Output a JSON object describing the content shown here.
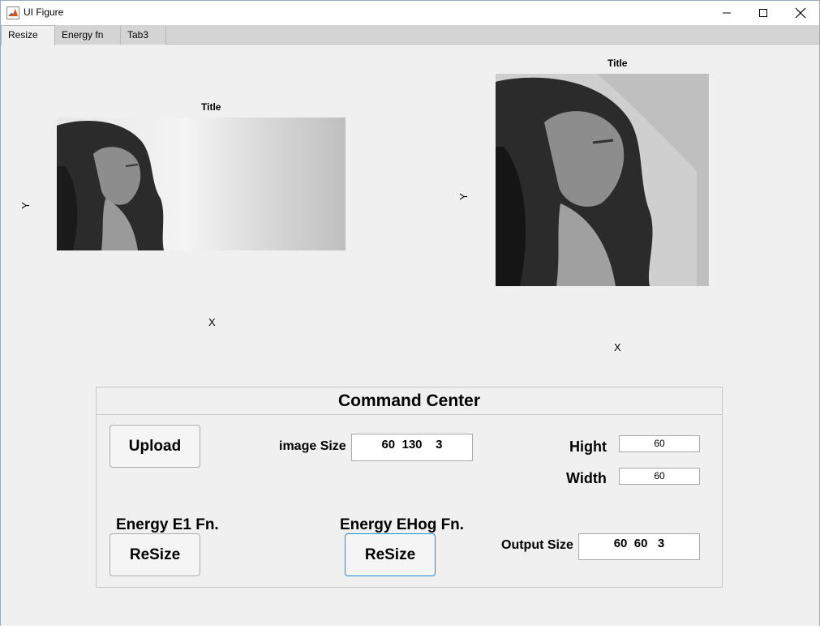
{
  "window": {
    "title": "UI Figure",
    "controls": {
      "minimize": "minimize-icon",
      "maximize": "maximize-icon",
      "close": "close-icon"
    },
    "accent": "#1a8fd6"
  },
  "tabs": [
    {
      "label": "Resize",
      "selected": true
    },
    {
      "label": "Energy fn",
      "selected": false
    },
    {
      "label": "Tab3",
      "selected": false
    }
  ],
  "axes_left": {
    "title": "Title",
    "xlabel": "X",
    "ylabel": "Y"
  },
  "axes_right": {
    "title": "Title",
    "xlabel": "X",
    "ylabel": "Y"
  },
  "command_center": {
    "title": "Command Center",
    "upload_label": "Upload",
    "image_size_label": "image Size",
    "image_size_value": "60  130    3",
    "hight_label": "Hight",
    "hight_value": "60",
    "width_label": "Width",
    "width_value": "60",
    "energy_e1_label": "Energy E1 Fn.",
    "energy_e1_button": "ReSize",
    "energy_ehog_label": "Energy EHog Fn.",
    "energy_ehog_button": "ReSize",
    "output_size_label": "Output Size",
    "output_size_value": "60  60   3"
  }
}
